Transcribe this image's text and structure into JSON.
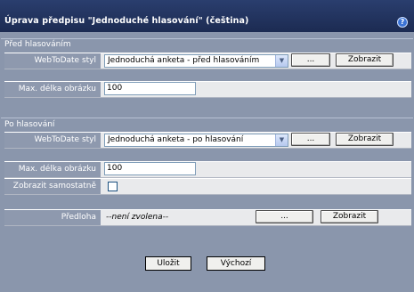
{
  "window": {
    "title": "Úprava předpisu \"Jednoduché hlasování\" (čeština)",
    "help": "?"
  },
  "before": {
    "section_label": "Před hlasováním",
    "style_label": "WebToDate styl",
    "style_value": "Jednoduchá anketa - před hlasováním",
    "browse_label": "...",
    "show_label": "Zobrazit",
    "maxlen_label": "Max. délka obrázku",
    "maxlen_value": "100"
  },
  "after": {
    "section_label": "Po hlasování",
    "style_label": "WebToDate styl",
    "style_value": "Jednoduchá anketa - po hlasování",
    "browse_label": "...",
    "show_label": "Zobrazit",
    "maxlen_label": "Max. délka obrázku",
    "maxlen_value": "100",
    "standalone_label": "Zobrazit samostatně",
    "standalone_checked": false
  },
  "template": {
    "label": "Předloha",
    "value": "--není zvolena--",
    "browse_label": "...",
    "show_label": "Zobrazit"
  },
  "footer": {
    "save_label": "Uložit",
    "default_label": "Výchozí"
  }
}
